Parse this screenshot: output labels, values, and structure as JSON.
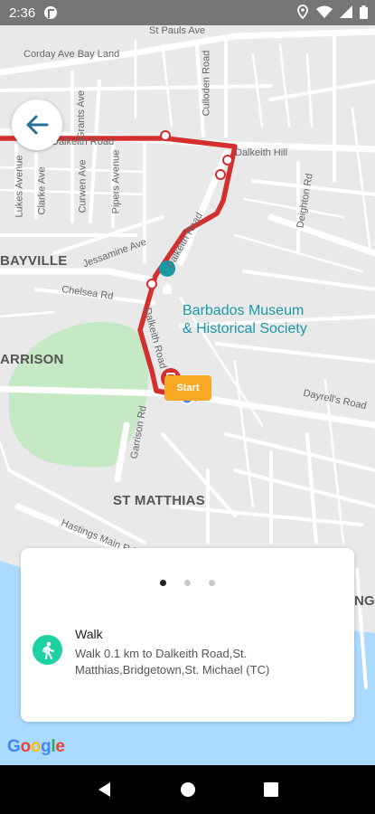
{
  "status_bar": {
    "time": "2:36"
  },
  "map": {
    "streets": [
      "St Pauls Ave",
      "Corday Ave Bay Land",
      "Dalkeith Road",
      "Dalkeith Hill",
      "Lukes Avenue",
      "Clarke Ave",
      "Grants Ave",
      "Curwen Ave",
      "Pipers Avenue",
      "Culloden Road",
      "Deighton Rd",
      "Jessamine Ave",
      "Chelsea Rd",
      "Dalkeith Road",
      "Dalkeith Road",
      "Garrison Rd",
      "Dayrell's Road",
      "Hastings Main Rd"
    ],
    "areas": [
      "BAYVILLE",
      "ARRISON",
      "ST MATTHIAS",
      "NG"
    ],
    "poi": {
      "line1": "Barbados Museum",
      "line2": "& Historical Society"
    },
    "start_marker": "Start"
  },
  "card": {
    "pager": {
      "total": 3,
      "active": 0
    },
    "step": {
      "title": "Walk",
      "description": "Walk 0.1 km to Dalkeith Road,St. Matthias,Bridgetown,St. Michael (TC)"
    }
  },
  "map_attribution": "Google",
  "colors": {
    "route": "#d32f2f",
    "water": "#aadaff",
    "park": "#c5e8c5",
    "walk": "#1dd1a1",
    "start": "#f9a825",
    "poi": "#1a9aa7"
  }
}
